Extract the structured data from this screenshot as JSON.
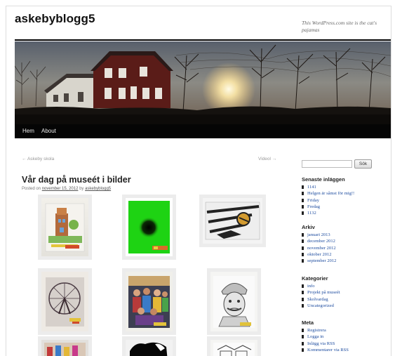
{
  "site": {
    "title": "askebyblogg5",
    "description": "This WordPress.com site is the cat's pajamas"
  },
  "nav": {
    "items": [
      {
        "label": "Hem"
      },
      {
        "label": "About"
      }
    ]
  },
  "post_nav": {
    "previous": "← Askeby skola",
    "next": "Videol →"
  },
  "post": {
    "title": "Vår dag på museét i bilder",
    "meta_prefix": "Posted on",
    "date": "november 15, 2012",
    "meta_by": "by",
    "author": "askebyblogg5"
  },
  "search": {
    "placeholder": "",
    "button_label": "Sök"
  },
  "sidebar": {
    "recent": {
      "title": "Senaste inläggen",
      "items": [
        "1141",
        "Helgen är såmst för mig!!",
        "Friday",
        "Fredag",
        "1132"
      ]
    },
    "archive": {
      "title": "Arkiv",
      "items": [
        "januari 2013",
        "december 2012",
        "november 2012",
        "oktober 2012",
        "september 2012"
      ]
    },
    "categories": {
      "title": "Kategorier",
      "items": [
        "info",
        "Projekt på museét",
        "Skolvardag",
        "Uncategorized"
      ]
    },
    "meta": {
      "title": "Meta",
      "items": [
        "Registrera",
        "Logga in",
        "Inlägg via RSS",
        "Kommentarer via RSS"
      ]
    }
  },
  "colors": {
    "nav_bg": "#050505",
    "link": "#1b4a9e",
    "text": "#222222"
  }
}
